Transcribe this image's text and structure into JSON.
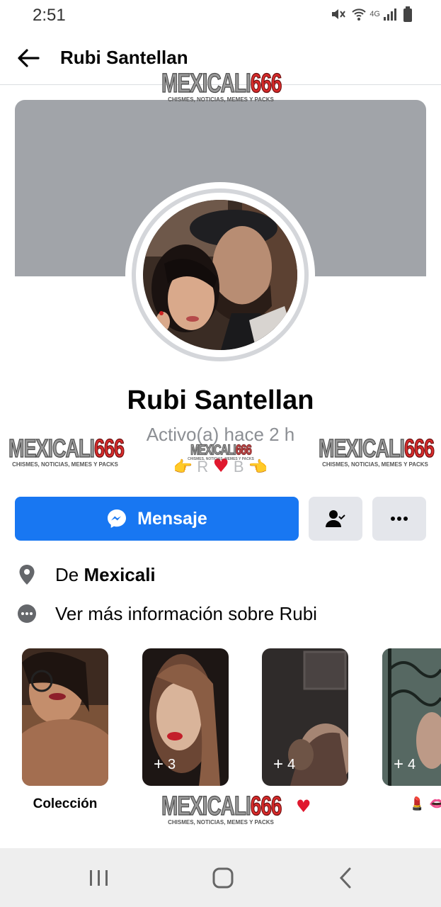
{
  "status_bar": {
    "time": "2:51",
    "network": "4G"
  },
  "header": {
    "title": "Rubi Santellan"
  },
  "watermarks": {
    "brand_a": "MEXICALI",
    "brand_b": "666",
    "tagline": "CHISMES, NOTICIAS, MEMES Y PACKS"
  },
  "profile": {
    "name": "Rubi Santellan",
    "active_status": "Activo(a) hace 2 h",
    "bio": {
      "pointer_left": "👉",
      "initial_left": "R",
      "heart": "♥",
      "initial_right": "B",
      "pointer_right": "👈"
    }
  },
  "actions": {
    "message_label": "Mensaje"
  },
  "about": {
    "from_prefix": "De",
    "from_city": "Mexicali",
    "more_info": "Ver más información sobre Rubi"
  },
  "highlights": [
    {
      "label": "Colección",
      "count": ""
    },
    {
      "label": "",
      "count": "3"
    },
    {
      "label": "♥",
      "count": "4"
    },
    {
      "label": "💄 👄",
      "count": "4"
    }
  ],
  "colors": {
    "accent": "#1877f2",
    "cover": "#a1a4a9",
    "button_gray": "#e4e6eb",
    "heart": "#e0182e"
  }
}
